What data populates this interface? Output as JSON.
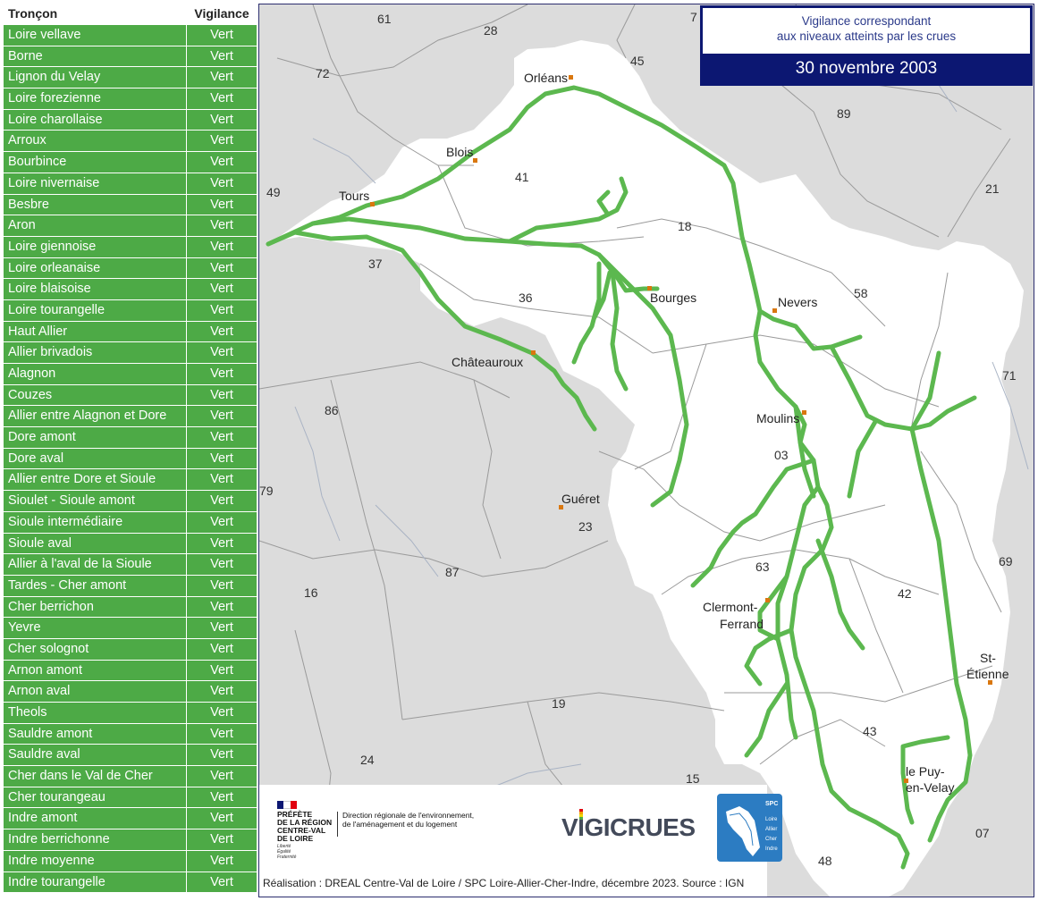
{
  "table": {
    "header": {
      "troncon": "Tronçon",
      "vigilance": "Vigilance"
    },
    "rows": [
      {
        "name": "Loire vellave",
        "level": "Vert"
      },
      {
        "name": "Borne",
        "level": "Vert"
      },
      {
        "name": "Lignon du Velay",
        "level": "Vert"
      },
      {
        "name": "Loire forezienne",
        "level": "Vert"
      },
      {
        "name": "Loire charollaise",
        "level": "Vert"
      },
      {
        "name": "Arroux",
        "level": "Vert"
      },
      {
        "name": "Bourbince",
        "level": "Vert"
      },
      {
        "name": "Loire nivernaise",
        "level": "Vert"
      },
      {
        "name": "Besbre",
        "level": "Vert"
      },
      {
        "name": "Aron",
        "level": "Vert"
      },
      {
        "name": "Loire giennoise",
        "level": "Vert"
      },
      {
        "name": "Loire orleanaise",
        "level": "Vert"
      },
      {
        "name": "Loire blaisoise",
        "level": "Vert"
      },
      {
        "name": "Loire tourangelle",
        "level": "Vert"
      },
      {
        "name": "Haut Allier",
        "level": "Vert"
      },
      {
        "name": "Allier brivadois",
        "level": "Vert"
      },
      {
        "name": "Alagnon",
        "level": "Vert"
      },
      {
        "name": "Couzes",
        "level": "Vert"
      },
      {
        "name": "Allier entre Alagnon et Dore",
        "level": "Vert"
      },
      {
        "name": "Dore amont",
        "level": "Vert"
      },
      {
        "name": "Dore aval",
        "level": "Vert"
      },
      {
        "name": "Allier entre Dore et Sioule",
        "level": "Vert"
      },
      {
        "name": "Sioulet - Sioule amont",
        "level": "Vert"
      },
      {
        "name": "Sioule intermédiaire",
        "level": "Vert"
      },
      {
        "name": "Sioule aval",
        "level": "Vert"
      },
      {
        "name": "Allier à l'aval de la Sioule",
        "level": "Vert"
      },
      {
        "name": "Tardes - Cher amont",
        "level": "Vert"
      },
      {
        "name": "Cher berrichon",
        "level": "Vert"
      },
      {
        "name": "Yevre",
        "level": "Vert"
      },
      {
        "name": "Cher solognot",
        "level": "Vert"
      },
      {
        "name": "Arnon amont",
        "level": "Vert"
      },
      {
        "name": "Arnon aval",
        "level": "Vert"
      },
      {
        "name": "Theols",
        "level": "Vert"
      },
      {
        "name": "Sauldre amont",
        "level": "Vert"
      },
      {
        "name": "Sauldre aval",
        "level": "Vert"
      },
      {
        "name": "Cher dans le Val de Cher",
        "level": "Vert"
      },
      {
        "name": "Cher tourangeau",
        "level": "Vert"
      },
      {
        "name": "Indre amont",
        "level": "Vert"
      },
      {
        "name": "Indre berrichonne",
        "level": "Vert"
      },
      {
        "name": "Indre moyenne",
        "level": "Vert"
      },
      {
        "name": "Indre tourangelle",
        "level": "Vert"
      }
    ]
  },
  "title_box": {
    "line1": "Vigilance correspondant",
    "line2": "aux niveaux atteints par les crues",
    "date": "30 novembre 2003"
  },
  "colors": {
    "vert": "#4daa46",
    "river": "#5cb84f",
    "navy": "#0c1772",
    "city_marker": "#d9770f",
    "basin": "#ffffff",
    "outside": "#dcdcdc"
  },
  "cities": {
    "orleans": "Orléans",
    "blois": "Blois",
    "tours": "Tours",
    "bourges": "Bourges",
    "nevers": "Nevers",
    "chateauroux": "Châteauroux",
    "moulins": "Moulins",
    "gueret": "Guéret",
    "clermont1": "Clermont-",
    "clermont2": "Ferrand",
    "st_etienne1": "St-",
    "st_etienne2": "Étienne",
    "le_puy1": "le Puy-",
    "le_puy2": "en-Velay"
  },
  "departments": {
    "d61": "61",
    "d28": "28",
    "d7": "7",
    "d45": "45",
    "d72": "72",
    "d89": "89",
    "d49": "49",
    "d41": "41",
    "d21": "21",
    "d18": "18",
    "d37": "37",
    "d36": "36",
    "d58": "58",
    "d71": "71",
    "d86": "86",
    "d03": "03",
    "d79": "79",
    "d23": "23",
    "d63": "63",
    "d69": "69",
    "d87": "87",
    "d16": "16",
    "d42": "42",
    "d19": "19",
    "d43": "43",
    "d24": "24",
    "d15": "15",
    "d07": "07",
    "d48": "48"
  },
  "footer": {
    "prefet_line1": "PRÉFÈTE",
    "prefet_line2": "DE LA RÉGION",
    "prefet_line3": "CENTRE-VAL",
    "prefet_line4": "DE LOIRE",
    "motto1": "Liberté",
    "motto2": "Égalité",
    "motto3": "Fraternité",
    "dreal_line1": "Direction régionale de l'environnement,",
    "dreal_line2": "de l'aménagement et du logement",
    "vigicrues": "VIGICRUES",
    "spc_title": "SPC",
    "spc_loire": "Loire",
    "spc_allier": "Allier",
    "spc_cher": "Cher",
    "spc_indre": "Indre",
    "credits": "Réalisation : DREAL Centre-Val de Loire / SPC Loire-Allier-Cher-Indre, décembre 2023. Source : IGN"
  }
}
